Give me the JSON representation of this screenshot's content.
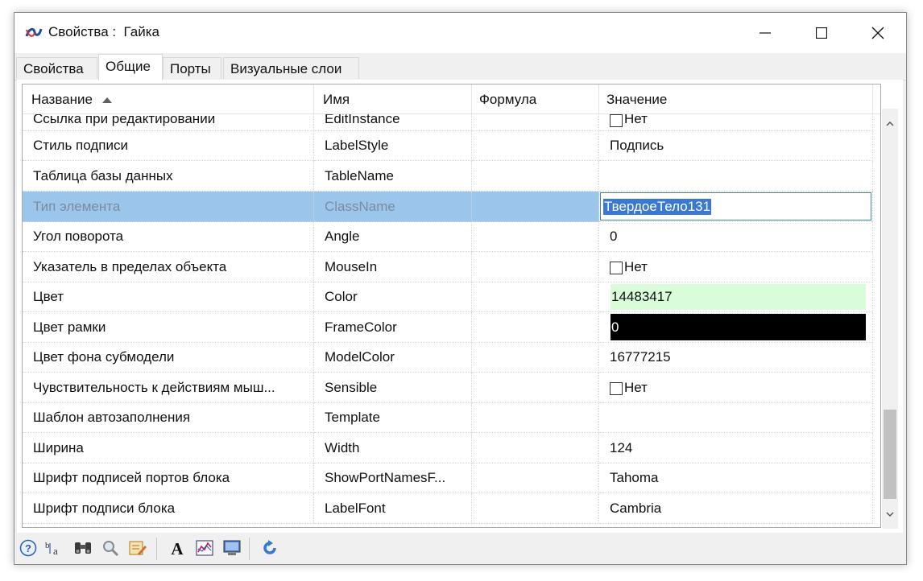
{
  "window": {
    "title": "Свойства :  Гайка",
    "controls": [
      "minimize-icon",
      "maximize-icon",
      "close-icon"
    ]
  },
  "tabs": [
    {
      "label": "Свойства",
      "active": false
    },
    {
      "label": "Общие",
      "active": true
    },
    {
      "label": "Порты",
      "active": false
    },
    {
      "label": "Визуальные слои",
      "active": false
    }
  ],
  "grid": {
    "columns": {
      "name": "Название",
      "sort_icon": "sort-ascending-icon",
      "id": "Имя",
      "formula": "Формула",
      "value": "Значение"
    },
    "rows": [
      {
        "name": "Ссылка при редактировании",
        "id": "EditInstance",
        "formula": "",
        "value": "Нет",
        "kind": "checkbox",
        "checked": false
      },
      {
        "name": "Стиль подписи",
        "id": "LabelStyle",
        "formula": "",
        "value": "Подпись",
        "kind": "text"
      },
      {
        "name": "Таблица базы данных",
        "id": "TableName",
        "formula": "",
        "value": "",
        "kind": "text"
      },
      {
        "name": "Тип элемента",
        "id": "ClassName",
        "formula": "",
        "value": "ТвердоеТело131",
        "kind": "editing",
        "selected": true
      },
      {
        "name": "Угол поворота",
        "id": "Angle",
        "formula": "",
        "value": "0",
        "kind": "text"
      },
      {
        "name": "Указатель в пределах объекта",
        "id": "MouseIn",
        "formula": "",
        "value": "Нет",
        "kind": "checkbox",
        "checked": false
      },
      {
        "name": "Цвет",
        "id": "Color",
        "formula": "",
        "value": "14483417",
        "kind": "color",
        "color": "#d9fdd9",
        "text_color": "#111111"
      },
      {
        "name": "Цвет рамки",
        "id": "FrameColor",
        "formula": "",
        "value": "0",
        "kind": "color",
        "color": "#000000",
        "text_color": "#ffffff"
      },
      {
        "name": "Цвет фона субмодели",
        "id": "ModelColor",
        "formula": "",
        "value": "16777215",
        "kind": "text"
      },
      {
        "name": "Чувствительность к действиям мыш...",
        "id": "Sensible",
        "formula": "",
        "value": "Нет",
        "kind": "checkbox",
        "checked": false
      },
      {
        "name": "Шаблон автозаполнения",
        "id": "Template",
        "formula": "",
        "value": "",
        "kind": "text"
      },
      {
        "name": "Ширина",
        "id": "Width",
        "formula": "",
        "value": "124",
        "kind": "text"
      },
      {
        "name": "Шрифт подписей портов блока",
        "id": "ShowPortNamesF...",
        "formula": "",
        "value": "Tahoma",
        "kind": "text"
      },
      {
        "name": "Шрифт подписи блока",
        "id": "LabelFont",
        "formula": "",
        "value": "Cambria",
        "kind": "text"
      }
    ]
  },
  "toolbar": {
    "buttons": [
      "help-icon",
      "sort-alpha-icon",
      "binoculars-icon",
      "magnifier-icon",
      "edit-properties-icon",
      "font-icon",
      "chart-icon",
      "monitor-icon",
      "refresh-icon"
    ]
  },
  "colors": {
    "selection": "#9cc5ec",
    "edit_highlight": "#3a78d4"
  }
}
